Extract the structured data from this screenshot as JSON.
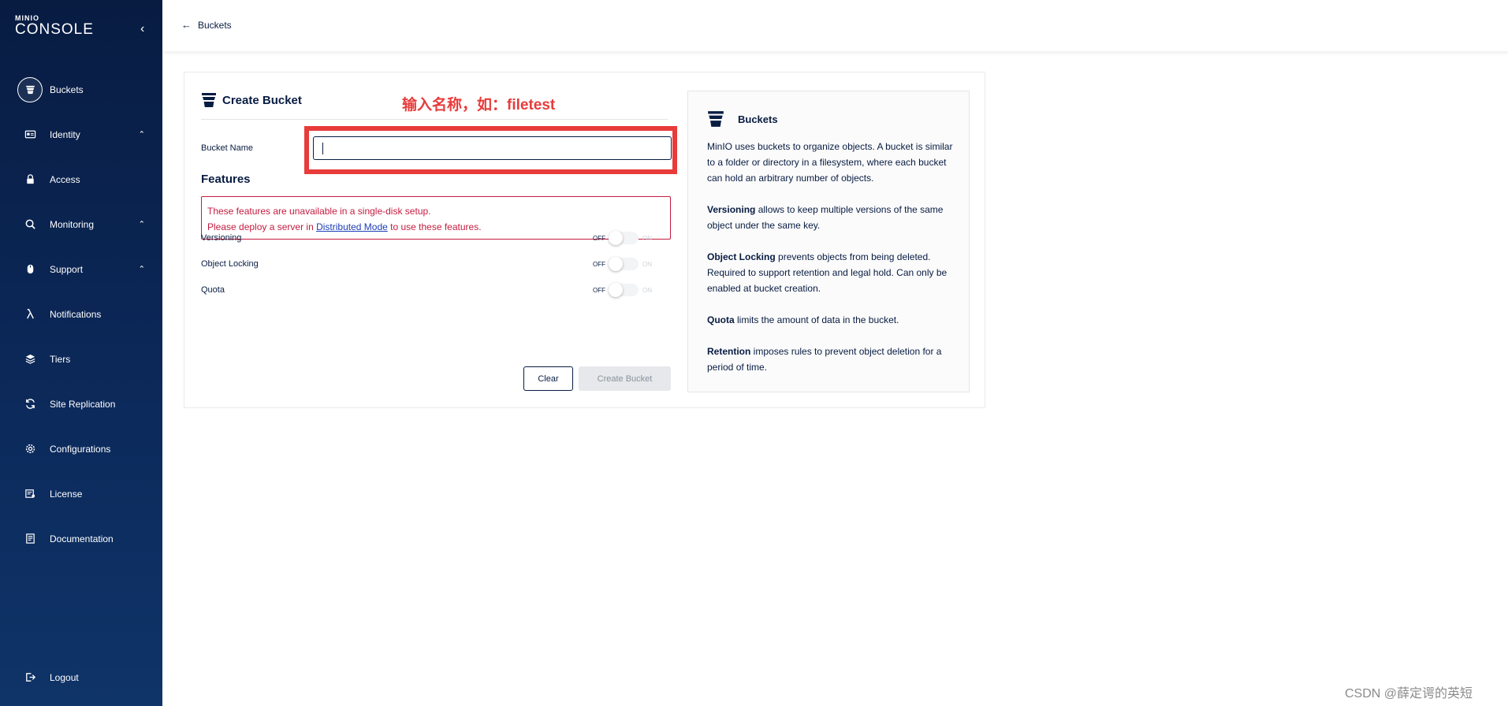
{
  "sidebar": {
    "brand": "MINIO",
    "product": "CONSOLE",
    "items": [
      {
        "label": "Buckets",
        "icon": "bucket-icon",
        "active": true,
        "chevron": false
      },
      {
        "label": "Identity",
        "icon": "identity-card-icon",
        "chevron": true
      },
      {
        "label": "Access",
        "icon": "lock-icon",
        "chevron": false
      },
      {
        "label": "Monitoring",
        "icon": "magnifier-icon",
        "chevron": true
      },
      {
        "label": "Support",
        "icon": "mouse-icon",
        "chevron": true
      },
      {
        "label": "Notifications",
        "icon": "lambda-icon",
        "chevron": false
      },
      {
        "label": "Tiers",
        "icon": "layers-icon",
        "chevron": false
      },
      {
        "label": "Site Replication",
        "icon": "sync-icon",
        "chevron": false
      },
      {
        "label": "Configurations",
        "icon": "gear-icon",
        "chevron": false
      },
      {
        "label": "License",
        "icon": "license-icon",
        "chevron": false
      },
      {
        "label": "Documentation",
        "icon": "document-icon",
        "chevron": false
      }
    ],
    "logout_label": "Logout"
  },
  "topbar": {
    "back_label": "Buckets"
  },
  "form": {
    "title": "Create Bucket",
    "annotation": "输入名称，如：filetest",
    "bucket_name_label": "Bucket Name",
    "bucket_name_value": "",
    "features_title": "Features",
    "warning_line1": "These features are unavailable in a single-disk setup.",
    "warning_line2_before": "Please deploy a server in ",
    "warning_link": "Distributed Mode",
    "warning_line2_after": " to use these features.",
    "toggles": [
      {
        "label": "Versioning",
        "off": "OFF",
        "on": "ON",
        "checked": false
      },
      {
        "label": "Object Locking",
        "off": "OFF",
        "on": "ON",
        "checked": false
      },
      {
        "label": "Quota",
        "off": "OFF",
        "on": "ON",
        "checked": false
      }
    ],
    "clear_label": "Clear",
    "create_label": "Create Bucket"
  },
  "help": {
    "title": "Buckets",
    "intro": "MinIO uses buckets to organize objects. A bucket is similar to a folder or directory in a filesystem, where each bucket can hold an arbitrary number of objects.",
    "versioning_term": "Versioning",
    "versioning_text": " allows to keep multiple versions of the same object under the same key.",
    "locking_term": "Object Locking",
    "locking_text": " prevents objects from being deleted. Required to support retention and legal hold. Can only be enabled at bucket creation.",
    "quota_term": "Quota",
    "quota_text": " limits the amount of data in the bucket.",
    "retention_term": "Retention",
    "retention_text": " imposes rules to prevent object deletion for a period of time."
  },
  "watermark": "CSDN @薛定谔的英短",
  "colors": {
    "sidebar_bg": "#081c42",
    "accent_red": "#e83b3b",
    "warning_red": "#c51b3f",
    "link_blue": "#1c3db8"
  }
}
